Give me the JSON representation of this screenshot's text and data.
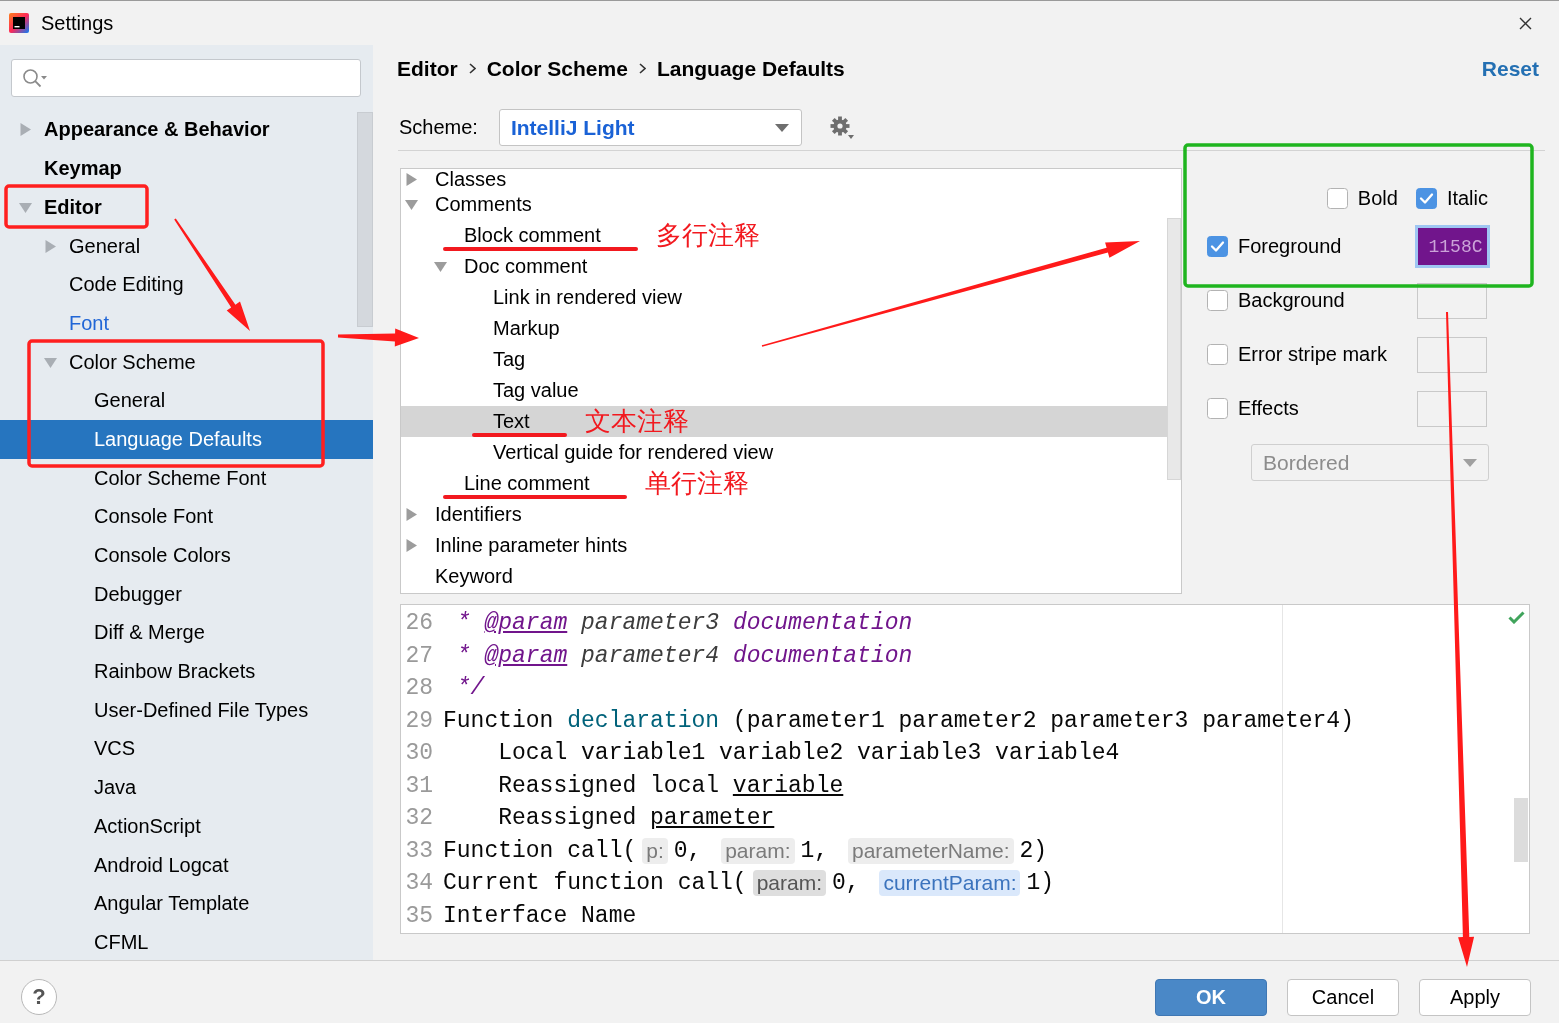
{
  "window": {
    "title": "Settings"
  },
  "sidebar": {
    "items": [
      {
        "label": "Appearance & Behavior",
        "expanded": false,
        "selected": false,
        "modified": false
      },
      {
        "label": "Keymap",
        "selected": false,
        "modified": false
      },
      {
        "label": "Editor",
        "expanded": true,
        "selected": false,
        "modified": false,
        "children": [
          {
            "label": "General",
            "expanded": false,
            "selected": false,
            "modified": false
          },
          {
            "label": "Code Editing",
            "selected": false,
            "modified": false
          },
          {
            "label": "Font",
            "selected": false,
            "modified": true
          },
          {
            "label": "Color Scheme",
            "expanded": true,
            "selected": false,
            "modified": false,
            "children": [
              {
                "label": "General",
                "selected": false,
                "modified": false
              },
              {
                "label": "Language Defaults",
                "selected": true,
                "modified": false
              },
              {
                "label": "Color Scheme Font",
                "selected": false,
                "modified": false
              },
              {
                "label": "Console Font",
                "selected": false,
                "modified": false
              },
              {
                "label": "Console Colors",
                "selected": false,
                "modified": false
              },
              {
                "label": "Debugger",
                "selected": false,
                "modified": false
              },
              {
                "label": "Diff & Merge",
                "selected": false,
                "modified": false
              },
              {
                "label": "Rainbow Brackets",
                "selected": false,
                "modified": false
              },
              {
                "label": "User-Defined File Types",
                "selected": false,
                "modified": false
              },
              {
                "label": "VCS",
                "selected": false,
                "modified": false
              },
              {
                "label": "Java",
                "selected": false,
                "modified": false
              },
              {
                "label": "ActionScript",
                "selected": false,
                "modified": false
              },
              {
                "label": "Android Logcat",
                "selected": false,
                "modified": false
              },
              {
                "label": "Angular Template",
                "selected": false,
                "modified": false
              },
              {
                "label": "CFML",
                "selected": false,
                "modified": false
              }
            ]
          }
        ]
      }
    ]
  },
  "breadcrumb": [
    "Editor",
    "Color Scheme",
    "Language Defaults"
  ],
  "reset_link": "Reset",
  "scheme": {
    "label": "Scheme:",
    "value": "IntelliJ Light"
  },
  "attributes": {
    "items": [
      {
        "label": "Classes",
        "expanded": false,
        "selected": false
      },
      {
        "label": "Comments",
        "expanded": true,
        "selected": false,
        "children": [
          {
            "label": "Block comment",
            "selected": false,
            "note": "多行注释"
          },
          {
            "label": "Doc comment",
            "expanded": true,
            "selected": false,
            "children": [
              {
                "label": "Link in rendered view",
                "selected": false
              },
              {
                "label": "Markup",
                "selected": false
              },
              {
                "label": "Tag",
                "selected": false
              },
              {
                "label": "Tag value",
                "selected": false
              },
              {
                "label": "Text",
                "selected": true,
                "note": "文本注释"
              },
              {
                "label": "Vertical guide for rendered view",
                "selected": false
              }
            ]
          },
          {
            "label": "Line comment",
            "selected": false,
            "note": "单行注释"
          }
        ]
      },
      {
        "label": "Identifiers",
        "expanded": false,
        "selected": false
      },
      {
        "label": "Inline parameter hints",
        "expanded": false,
        "selected": false
      },
      {
        "label": "Keyword",
        "selected": false
      }
    ]
  },
  "font_style": [
    {
      "label": "Bold",
      "checked": false
    },
    {
      "label": "Italic",
      "checked": true
    }
  ],
  "color_options": [
    {
      "label": "Foreground",
      "checked": true,
      "focused": true,
      "color": "#71158c",
      "value": "1158C"
    },
    {
      "label": "Background",
      "checked": false,
      "focused": false
    },
    {
      "label": "Error stripe mark",
      "checked": false,
      "focused": false
    },
    {
      "label": "Effects",
      "checked": false,
      "focused": false
    }
  ],
  "effect_type": {
    "value": "Bordered",
    "disabled": true
  },
  "preview": {
    "lines": [
      {
        "number": "26",
        "tokens": [
          {
            "kind": "doc",
            "text": " * "
          },
          {
            "kind": "doc-tag",
            "text": "@param"
          },
          {
            "kind": "doc-param",
            "text": " parameter3 "
          },
          {
            "kind": "doc",
            "text": "documentation"
          }
        ]
      },
      {
        "number": "27",
        "tokens": [
          {
            "kind": "doc",
            "text": " * "
          },
          {
            "kind": "doc-tag",
            "text": "@param"
          },
          {
            "kind": "doc-param",
            "text": " parameter4 "
          },
          {
            "kind": "doc",
            "text": "documentation"
          }
        ]
      },
      {
        "number": "28",
        "tokens": [
          {
            "kind": "doc",
            "text": " */"
          }
        ]
      },
      {
        "number": "29",
        "tokens": [
          {
            "kind": "plain",
            "text": "Function "
          },
          {
            "kind": "declaration",
            "text": "declaration"
          },
          {
            "kind": "plain",
            "text": " (parameter1 parameter2 parameter3 parameter4)"
          }
        ]
      },
      {
        "number": "30",
        "tokens": [
          {
            "kind": "plain",
            "text": "    Local variable1 variable2 variable3 variable4"
          }
        ]
      },
      {
        "number": "31",
        "tokens": [
          {
            "kind": "plain",
            "text": "    Reassigned local "
          },
          {
            "kind": "reassigned",
            "text": "variable"
          }
        ]
      },
      {
        "number": "32",
        "tokens": [
          {
            "kind": "plain",
            "text": "    Reassigned "
          },
          {
            "kind": "reassigned",
            "text": "parameter"
          }
        ]
      },
      {
        "number": "33",
        "tokens": [
          {
            "kind": "plain",
            "text": "Function call("
          },
          {
            "kind": "hint",
            "text": "p:"
          },
          {
            "kind": "plain",
            "text": "0, "
          },
          {
            "kind": "hint",
            "text": "param:"
          },
          {
            "kind": "plain",
            "text": "1, "
          },
          {
            "kind": "hint",
            "text": "parameterName:"
          },
          {
            "kind": "plain",
            "text": "2)"
          }
        ]
      },
      {
        "number": "34",
        "tokens": [
          {
            "kind": "plain",
            "text": "Current function call("
          },
          {
            "kind": "hint-strong",
            "text": "param:"
          },
          {
            "kind": "plain",
            "text": "0, "
          },
          {
            "kind": "hint-current",
            "text": "currentParam:"
          },
          {
            "kind": "plain",
            "text": "1)"
          }
        ]
      },
      {
        "number": "35",
        "tokens": [
          {
            "kind": "plain",
            "text": "Interface Name"
          }
        ]
      }
    ]
  },
  "help": "?",
  "buttons": [
    {
      "label": "OK",
      "default": true
    },
    {
      "label": "Cancel",
      "default": false
    },
    {
      "label": "Apply",
      "default": false
    }
  ]
}
